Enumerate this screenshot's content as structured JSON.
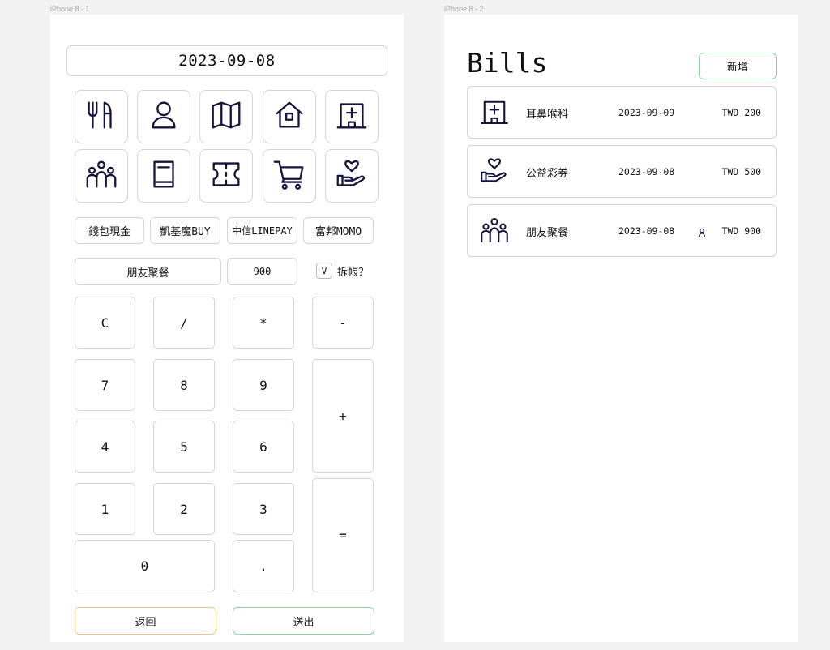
{
  "frames": {
    "left_label": "iPhone 8 - 1",
    "right_label": "iPhone 8 - 2"
  },
  "entry": {
    "date": "2023-09-08",
    "categories": [
      {
        "icon": "utensils-icon"
      },
      {
        "icon": "person-icon"
      },
      {
        "icon": "map-icon"
      },
      {
        "icon": "home-icon"
      },
      {
        "icon": "hospital-icon"
      },
      {
        "icon": "group-icon"
      },
      {
        "icon": "book-icon"
      },
      {
        "icon": "ticket-icon"
      },
      {
        "icon": "cart-icon"
      },
      {
        "icon": "charity-icon"
      }
    ],
    "accounts": [
      "錢包現金",
      "凱基魔BUY",
      "中信LINEPAY",
      "富邦MOMO"
    ],
    "note": "朋友聚餐",
    "amount": "900",
    "split_check": "V",
    "split_label": "拆帳？",
    "keys": {
      "clear": "C",
      "divide": "/",
      "multiply": "*",
      "minus": "-",
      "seven": "7",
      "eight": "8",
      "nine": "9",
      "plus": "+",
      "four": "4",
      "five": "5",
      "six": "6",
      "one": "1",
      "two": "2",
      "three": "3",
      "equals": "=",
      "zero": "0",
      "dot": "."
    },
    "back_label": "返回",
    "send_label": "送出"
  },
  "bills": {
    "title": "Bills",
    "add_label": "新增",
    "items": [
      {
        "icon": "hospital-icon",
        "name": "耳鼻喉科",
        "date": "2023-09-09",
        "amount": "TWD 200",
        "split": false
      },
      {
        "icon": "charity-icon",
        "name": "公益彩券",
        "date": "2023-09-08",
        "amount": "TWD 500",
        "split": false
      },
      {
        "icon": "group-icon",
        "name": "朋友聚餐",
        "date": "2023-09-08",
        "amount": "TWD 900",
        "split": true
      }
    ]
  },
  "colors": {
    "border": "#d4d4d4",
    "icon": "#14143c",
    "back_border": "#f0c486",
    "send_border": "#8ed3a2"
  }
}
